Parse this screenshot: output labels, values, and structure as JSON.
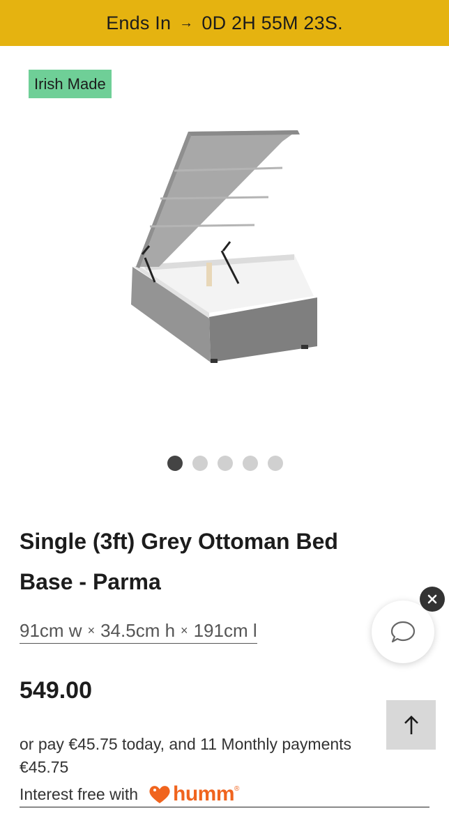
{
  "countdown": {
    "label": "Ends In",
    "arrow": "→",
    "time": "0D 2H 55M 23S."
  },
  "badge": "Irish Made",
  "carousel": {
    "count": 5,
    "active_index": 0
  },
  "product": {
    "title": "Single (3ft) Grey Ottoman Bed Base - Parma",
    "dimensions": {
      "width": "91cm w",
      "height": "34.5cm h",
      "length": "191cm l",
      "separator": "×"
    },
    "price": "549.00",
    "payment_text": "or pay €45.75 today, and 11 Monthly payments €45.75",
    "interest_text": "Interest free with",
    "provider": "humm",
    "provider_mark": "®"
  },
  "icons": {
    "chat": "chat-bubble-icon",
    "close": "close-icon",
    "scroll": "arrow-up-icon"
  },
  "colors": {
    "banner": "#e5b310",
    "badge": "#6fcf97",
    "humm": "#f0641e"
  }
}
